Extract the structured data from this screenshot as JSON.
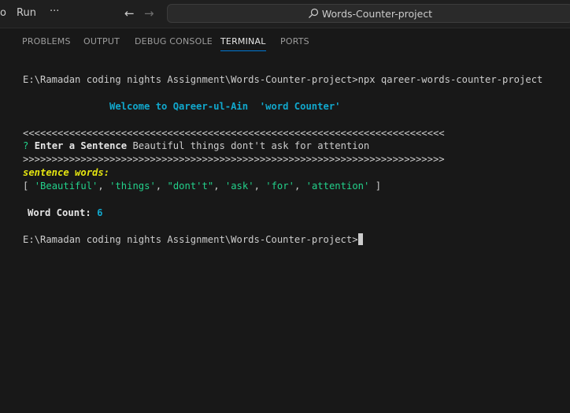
{
  "titlebar": {
    "menu_left_fragment": "o",
    "menu_run": "Run",
    "menu_more": "···",
    "back_arrow": "←",
    "forward_arrow": "→",
    "search_text": "Words-Counter-project"
  },
  "panel": {
    "tabs": [
      {
        "label": "PROBLEMS"
      },
      {
        "label": "OUTPUT"
      },
      {
        "label": "DEBUG CONSOLE"
      },
      {
        "label": "TERMINAL",
        "active": true
      },
      {
        "label": "PORTS"
      }
    ]
  },
  "terminal": {
    "command_line": "E:\\Ramadan coding nights Assignment\\Words-Counter-project>npx qareer-words-counter-project",
    "welcome": "Welcome to Qareer-ul-Ain  'word Counter'",
    "divider_top": "<<<<<<<<<<<<<<<<<<<<<<<<<<<<<<<<<<<<<<<<<<<<<<<<<<<<<<<<<<<<<<<<<<<<<<<<<",
    "question_mark": "?",
    "question_label": "Enter a Sentence",
    "answer": "Beautiful things dont't ask for attention",
    "divider_bottom": ">>>>>>>>>>>>>>>>>>>>>>>>>>>>>>>>>>>>>>>>>>>>>>>>>>>>>>>>>>>>>>>>>>>>>>>>>",
    "sentence_words_label": "sentence words:",
    "words": [
      "'Beautiful'",
      "'things'",
      "\"dont't\"",
      "'ask'",
      "'for'",
      "'attention'"
    ],
    "bracket_open": "[",
    "bracket_close": "]",
    "word_count_label": "Word Count:",
    "word_count_value": "6",
    "prompt_line": "E:\\Ramadan coding nights Assignment\\Words-Counter-project>"
  },
  "colors": {
    "accent": "#0078d4",
    "cyan": "#11a8cd",
    "green": "#23d18b",
    "yellow": "#e5e510"
  }
}
